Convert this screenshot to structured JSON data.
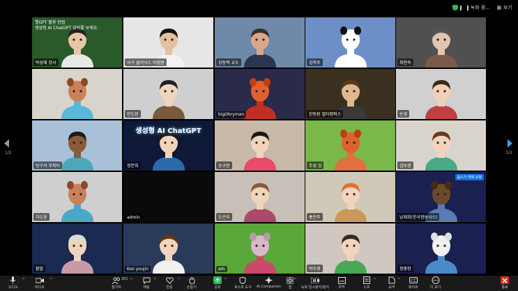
{
  "topbar": {
    "status_text": "녹화 중...",
    "view_label": "보기"
  },
  "pagination": {
    "left": "1/2",
    "right": "1/2"
  },
  "banner": {
    "line1": "챗GPT 활용 방법",
    "line2": "생성형 AI ChatGPT 강의를 보세요."
  },
  "tiles": [
    {
      "name": "박성재 강사",
      "bg": "#2a5a2a",
      "skin": "#e8c7a8",
      "hair": "#222",
      "shirt": "#e8e8e8",
      "kind": "person",
      "banner": true,
      "active": true
    },
    {
      "name": "사구 클리닉스 이정원",
      "bg": "#e6e6e6",
      "skin": "#e5c0a0",
      "hair": "#111",
      "shirt": "#f2f2f2",
      "kind": "person"
    },
    {
      "name": "강동혁 교수",
      "bg": "#6e8aa8",
      "skin": "#d9a888",
      "hair": "#333",
      "shirt": "#2b3552",
      "kind": "person"
    },
    {
      "name": "김옥주",
      "bg": "#6c8fc7",
      "skin": "#ffffff",
      "hair": "#111",
      "shirt": "#ffffff",
      "kind": "panda"
    },
    {
      "name": "최현숙",
      "bg": "#505050",
      "skin": "#e0c5b0",
      "hair": "#555",
      "shirt": "#7a5a4a",
      "kind": "person"
    },
    {
      "name": "",
      "bg": "#d8d4cc",
      "skin": "#c8825a",
      "hair": "#8a4a2a",
      "shirt": "#5ab8d8",
      "kind": "dog"
    },
    {
      "name": "안도현",
      "bg": "#cfcfcf",
      "skin": "#f0d4bc",
      "hair": "#222",
      "shirt": "#7a5a3a",
      "kind": "avatar"
    },
    {
      "name": "bigObryman",
      "bg": "#2a2a4a",
      "skin": "#e06030",
      "hair": "#c04010",
      "shirt": "#c03020",
      "kind": "fox"
    },
    {
      "name": "한동환 멀티캠퍼스",
      "bg": "#3a3020",
      "skin": "#e0b890",
      "hair": "#5a3a1a",
      "shirt": "#3a3a3a",
      "kind": "avatar"
    },
    {
      "name": "손경",
      "bg": "#d0d0d0",
      "skin": "#f0d0b8",
      "hair": "#3a2a1a",
      "shirt": "#c04040",
      "kind": "avatar"
    },
    {
      "name": "방구석 주피터",
      "bg": "#a8c0d8",
      "skin": "#8a5a3a",
      "hair": "#1a1a1a",
      "shirt": "#4aa8b8",
      "kind": "avatar"
    },
    {
      "name": "정문희",
      "bg": "#101838",
      "skin": "#f0d4bc",
      "hair": "#1a1a1a",
      "shirt": "#2a6aa8",
      "kind": "avatar",
      "gpt": "생성형 AI ChatGPT"
    },
    {
      "name": "송규현",
      "bg": "#c8b8a8",
      "skin": "#f0d4bc",
      "hair": "#1a1a1a",
      "shirt": "#e84a6a",
      "kind": "avatar"
    },
    {
      "name": "조성 김",
      "bg": "#7ab84a",
      "skin": "#e06030",
      "hair": "#c04010",
      "shirt": "#e07040",
      "kind": "fox"
    },
    {
      "name": "김보경",
      "bg": "#d8d4cc",
      "skin": "#f0d4bc",
      "hair": "#6a3a1a",
      "shirt": "#48a888",
      "kind": "avatar"
    },
    {
      "name": "차도윤",
      "bg": "#cfcfcf",
      "skin": "#c8825a",
      "hair": "#8a4a2a",
      "shirt": "#4aa8c8",
      "kind": "dog"
    },
    {
      "name": "admin",
      "bg": "#0a0a0a",
      "skin": "#000",
      "hair": "#000",
      "shirt": "#000",
      "kind": "blank"
    },
    {
      "name": "도은지",
      "bg": "#c8c0b8",
      "skin": "#f0d4bc",
      "hair": "#8a5a3a",
      "shirt": "#a84a6a",
      "kind": "avatar"
    },
    {
      "name": "홍은주",
      "bg": "#d0c8b8",
      "skin": "#f0d4bc",
      "hair": "#e07030",
      "shirt": "#c89a5a",
      "kind": "avatar"
    },
    {
      "name": "남재희(한국정보시스)",
      "bg": "#1a2050",
      "skin": "#6a4a2a",
      "hair": "#4a2a10",
      "shirt": "#5a7ab8",
      "kind": "bear",
      "rename": "옵스가 계획 요청"
    },
    {
      "name": "황필",
      "bg": "#1a2a50",
      "skin": "#f0d4bc",
      "hair": "#dcdcdc",
      "shirt": "#c89aa8",
      "kind": "avatar"
    },
    {
      "name": "Koo youjin",
      "bg": "#2a3a5a",
      "skin": "#f0d4bc",
      "hair": "#5a3a1a",
      "shirt": "#f0f0f0",
      "kind": "avatar"
    },
    {
      "name": "am",
      "bg": "#5aa83a",
      "skin": "#d8b8c8",
      "hair": "#b89aa8",
      "shirt": "#c84a6a",
      "kind": "mouse"
    },
    {
      "name": "박수경",
      "bg": "#d0c8c0",
      "skin": "#f0d4bc",
      "hair": "#3a2a1a",
      "shirt": "#48a858",
      "kind": "avatar"
    },
    {
      "name": "정충현",
      "bg": "#1a2050",
      "skin": "#f0f0f0",
      "hair": "#e0e0e0",
      "shirt": "#4a8ac8",
      "kind": "bear"
    }
  ],
  "toolbar": {
    "audio": "오디오",
    "video": "비디오",
    "participants": "참가자",
    "participants_count": "301",
    "chat": "채팅",
    "react": "반응",
    "raise": "손들기",
    "share": "공유",
    "host_tools": "호스트 도구",
    "companion": "AI Companion",
    "apps": "앱",
    "record": "녹화 일시정지/정지",
    "caption": "자막",
    "notes": "노트",
    "summary": "요약",
    "whiteboard": "화이트",
    "more": "더 보기",
    "end": "종료"
  },
  "colors": {
    "active_outline": "#3fcf5c",
    "end": "#e02828",
    "arrow": "#2ea8ff"
  }
}
